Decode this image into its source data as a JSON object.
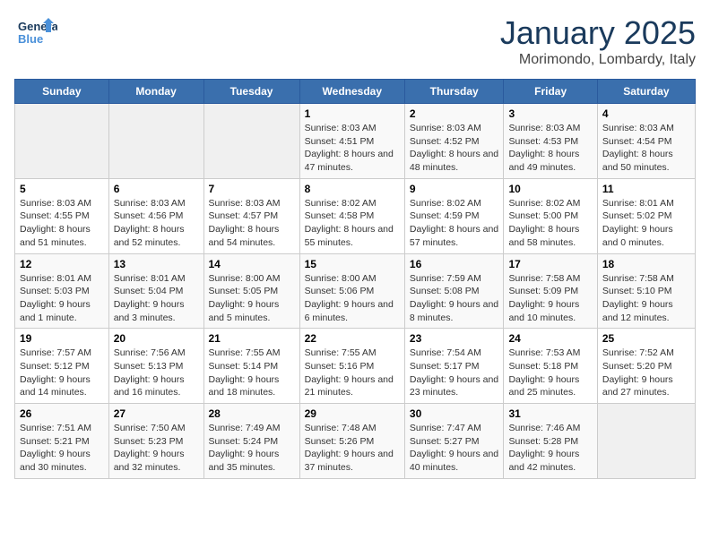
{
  "header": {
    "logo_line1": "General",
    "logo_line2": "Blue",
    "title": "January 2025",
    "subtitle": "Morimondo, Lombardy, Italy"
  },
  "days_of_week": [
    "Sunday",
    "Monday",
    "Tuesday",
    "Wednesday",
    "Thursday",
    "Friday",
    "Saturday"
  ],
  "weeks": [
    [
      {
        "day": "",
        "info": ""
      },
      {
        "day": "",
        "info": ""
      },
      {
        "day": "",
        "info": ""
      },
      {
        "day": "1",
        "info": "Sunrise: 8:03 AM\nSunset: 4:51 PM\nDaylight: 8 hours and 47 minutes."
      },
      {
        "day": "2",
        "info": "Sunrise: 8:03 AM\nSunset: 4:52 PM\nDaylight: 8 hours and 48 minutes."
      },
      {
        "day": "3",
        "info": "Sunrise: 8:03 AM\nSunset: 4:53 PM\nDaylight: 8 hours and 49 minutes."
      },
      {
        "day": "4",
        "info": "Sunrise: 8:03 AM\nSunset: 4:54 PM\nDaylight: 8 hours and 50 minutes."
      }
    ],
    [
      {
        "day": "5",
        "info": "Sunrise: 8:03 AM\nSunset: 4:55 PM\nDaylight: 8 hours and 51 minutes."
      },
      {
        "day": "6",
        "info": "Sunrise: 8:03 AM\nSunset: 4:56 PM\nDaylight: 8 hours and 52 minutes."
      },
      {
        "day": "7",
        "info": "Sunrise: 8:03 AM\nSunset: 4:57 PM\nDaylight: 8 hours and 54 minutes."
      },
      {
        "day": "8",
        "info": "Sunrise: 8:02 AM\nSunset: 4:58 PM\nDaylight: 8 hours and 55 minutes."
      },
      {
        "day": "9",
        "info": "Sunrise: 8:02 AM\nSunset: 4:59 PM\nDaylight: 8 hours and 57 minutes."
      },
      {
        "day": "10",
        "info": "Sunrise: 8:02 AM\nSunset: 5:00 PM\nDaylight: 8 hours and 58 minutes."
      },
      {
        "day": "11",
        "info": "Sunrise: 8:01 AM\nSunset: 5:02 PM\nDaylight: 9 hours and 0 minutes."
      }
    ],
    [
      {
        "day": "12",
        "info": "Sunrise: 8:01 AM\nSunset: 5:03 PM\nDaylight: 9 hours and 1 minute."
      },
      {
        "day": "13",
        "info": "Sunrise: 8:01 AM\nSunset: 5:04 PM\nDaylight: 9 hours and 3 minutes."
      },
      {
        "day": "14",
        "info": "Sunrise: 8:00 AM\nSunset: 5:05 PM\nDaylight: 9 hours and 5 minutes."
      },
      {
        "day": "15",
        "info": "Sunrise: 8:00 AM\nSunset: 5:06 PM\nDaylight: 9 hours and 6 minutes."
      },
      {
        "day": "16",
        "info": "Sunrise: 7:59 AM\nSunset: 5:08 PM\nDaylight: 9 hours and 8 minutes."
      },
      {
        "day": "17",
        "info": "Sunrise: 7:58 AM\nSunset: 5:09 PM\nDaylight: 9 hours and 10 minutes."
      },
      {
        "day": "18",
        "info": "Sunrise: 7:58 AM\nSunset: 5:10 PM\nDaylight: 9 hours and 12 minutes."
      }
    ],
    [
      {
        "day": "19",
        "info": "Sunrise: 7:57 AM\nSunset: 5:12 PM\nDaylight: 9 hours and 14 minutes."
      },
      {
        "day": "20",
        "info": "Sunrise: 7:56 AM\nSunset: 5:13 PM\nDaylight: 9 hours and 16 minutes."
      },
      {
        "day": "21",
        "info": "Sunrise: 7:55 AM\nSunset: 5:14 PM\nDaylight: 9 hours and 18 minutes."
      },
      {
        "day": "22",
        "info": "Sunrise: 7:55 AM\nSunset: 5:16 PM\nDaylight: 9 hours and 21 minutes."
      },
      {
        "day": "23",
        "info": "Sunrise: 7:54 AM\nSunset: 5:17 PM\nDaylight: 9 hours and 23 minutes."
      },
      {
        "day": "24",
        "info": "Sunrise: 7:53 AM\nSunset: 5:18 PM\nDaylight: 9 hours and 25 minutes."
      },
      {
        "day": "25",
        "info": "Sunrise: 7:52 AM\nSunset: 5:20 PM\nDaylight: 9 hours and 27 minutes."
      }
    ],
    [
      {
        "day": "26",
        "info": "Sunrise: 7:51 AM\nSunset: 5:21 PM\nDaylight: 9 hours and 30 minutes."
      },
      {
        "day": "27",
        "info": "Sunrise: 7:50 AM\nSunset: 5:23 PM\nDaylight: 9 hours and 32 minutes."
      },
      {
        "day": "28",
        "info": "Sunrise: 7:49 AM\nSunset: 5:24 PM\nDaylight: 9 hours and 35 minutes."
      },
      {
        "day": "29",
        "info": "Sunrise: 7:48 AM\nSunset: 5:26 PM\nDaylight: 9 hours and 37 minutes."
      },
      {
        "day": "30",
        "info": "Sunrise: 7:47 AM\nSunset: 5:27 PM\nDaylight: 9 hours and 40 minutes."
      },
      {
        "day": "31",
        "info": "Sunrise: 7:46 AM\nSunset: 5:28 PM\nDaylight: 9 hours and 42 minutes."
      },
      {
        "day": "",
        "info": ""
      }
    ]
  ]
}
